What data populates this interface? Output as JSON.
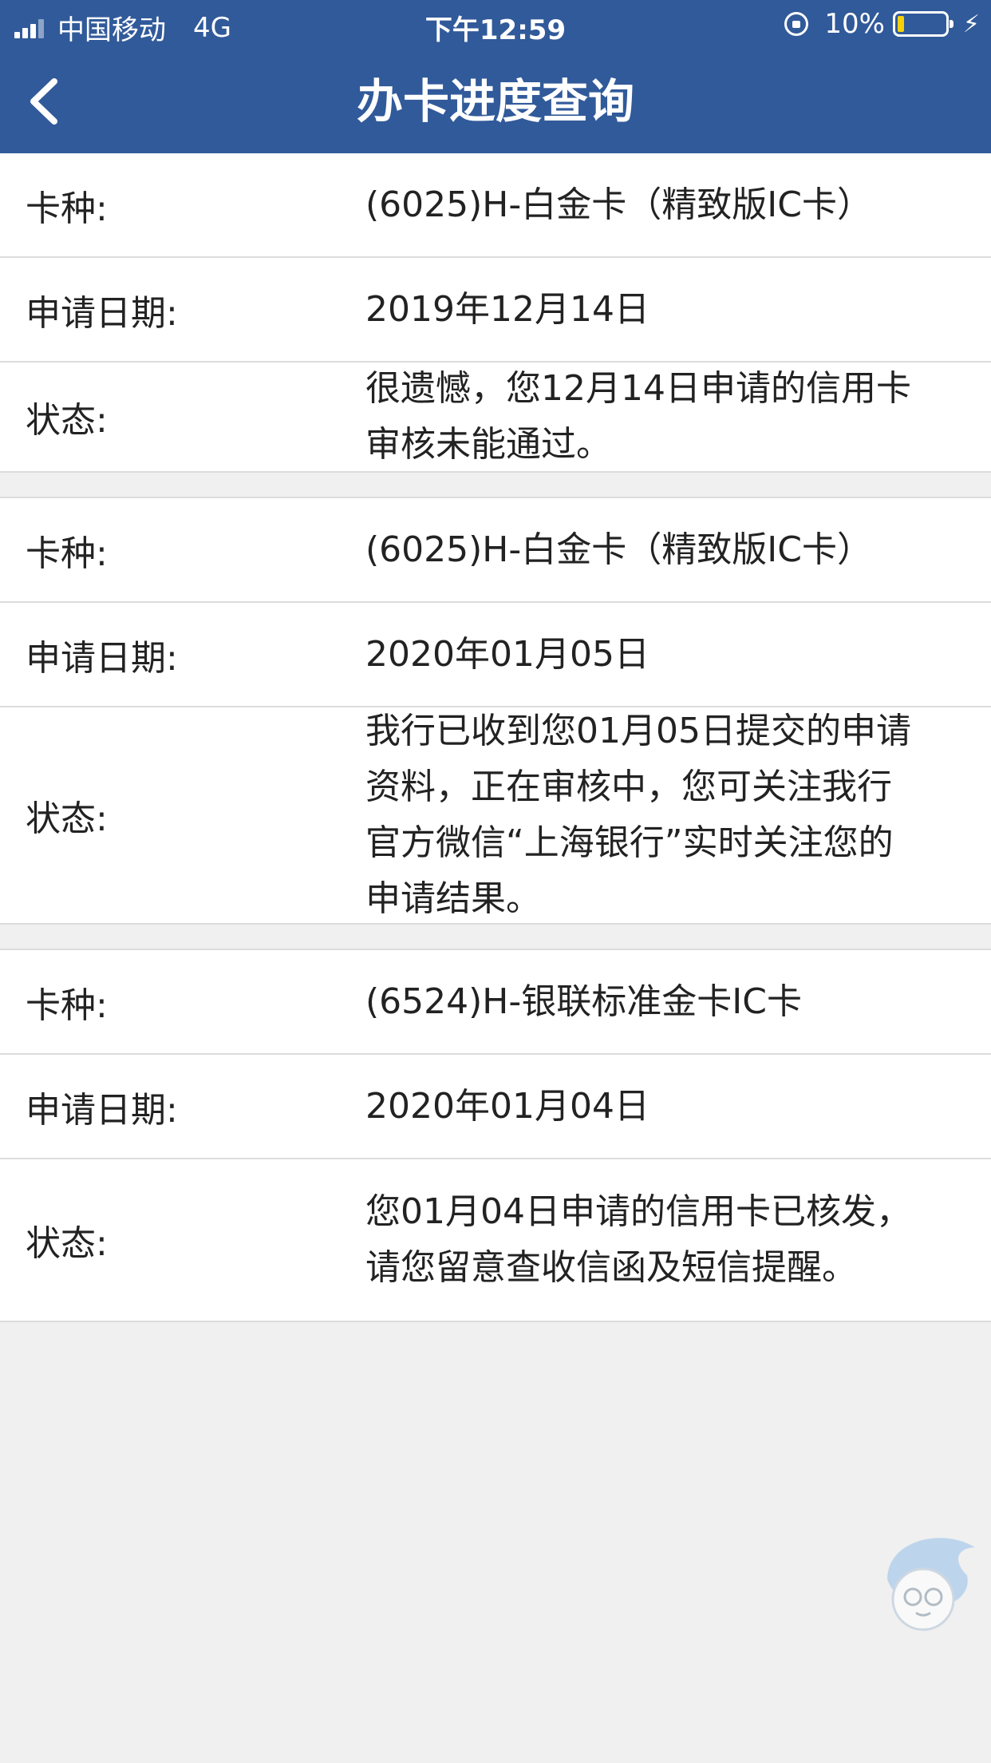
{
  "status_bar": {
    "carrier": "中国移动",
    "network": "4G",
    "time": "下午12:59",
    "battery_percent": "10%",
    "battery_level": 0.1,
    "icons": [
      "signal-icon",
      "rotation-lock-icon",
      "battery-icon",
      "charging-bolt-icon"
    ]
  },
  "nav": {
    "title": "办卡进度查询",
    "back_icon": "chevron-left-icon"
  },
  "labels": {
    "card_type": "卡种:",
    "apply_date": "申请日期:",
    "status": "状态:"
  },
  "records": [
    {
      "card_type": "(6025)H-白金卡（精致版IC卡）",
      "apply_date": "2019年12月14日",
      "status": "很遗憾，您12月14日申请的信用卡审核未能通过。"
    },
    {
      "card_type": "(6025)H-白金卡（精致版IC卡）",
      "apply_date": "2020年01月05日",
      "status": "我行已收到您01月05日提交的申请资料，正在审核中，您可关注我行官方微信“上海银行”实时关注您的申请结果。"
    },
    {
      "card_type": "(6524)H-银联标准金卡IC卡",
      "apply_date": "2020年01月04日",
      "status": "您01月04日申请的信用卡已核发，请您留意查收信函及短信提醒。"
    }
  ],
  "colors": {
    "header": "#315a9a",
    "background": "#f0f0f0",
    "divider": "#dcdcdc"
  }
}
